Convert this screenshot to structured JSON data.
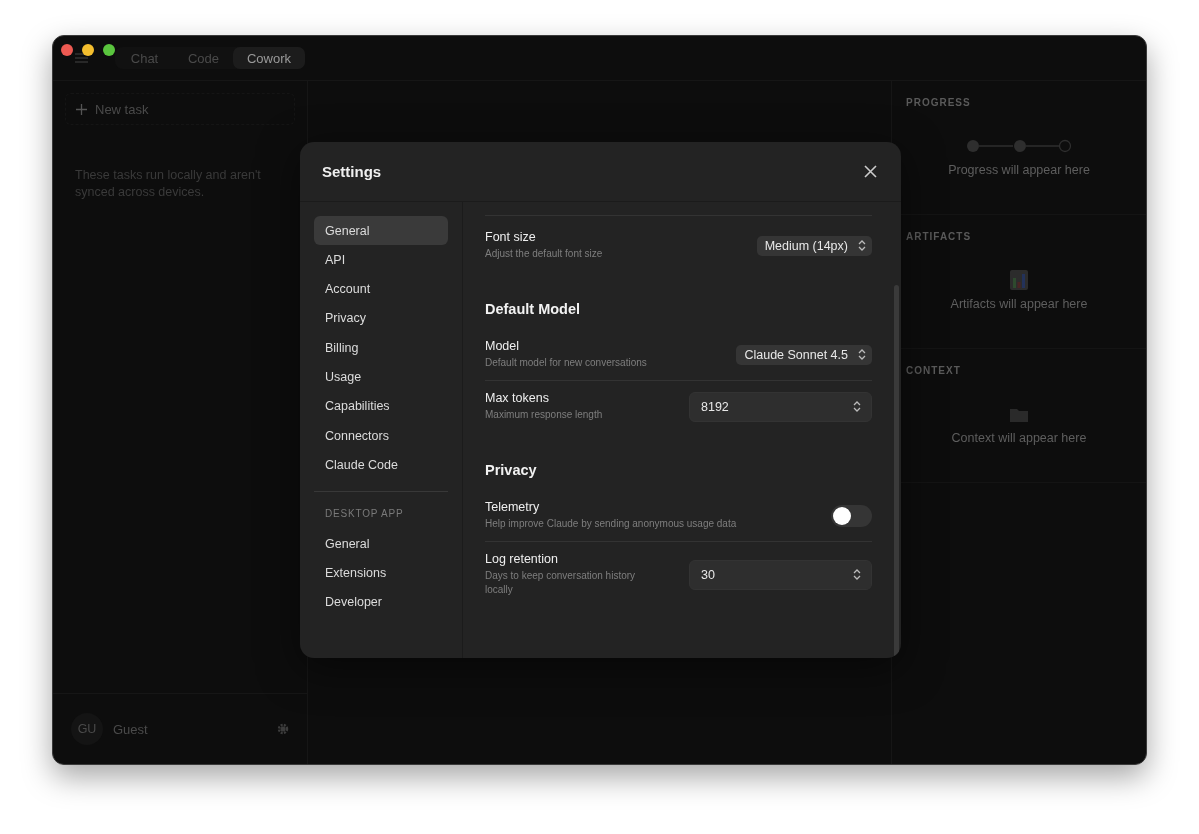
{
  "window": {
    "tabs": [
      {
        "label": "Chat",
        "selected": false
      },
      {
        "label": "Code",
        "selected": false
      },
      {
        "label": "Cowork",
        "selected": true
      }
    ]
  },
  "sidebar": {
    "new_task": "New task",
    "note": "These tasks run locally and aren't synced across devices.",
    "user": {
      "initials": "GU",
      "name": "Guest"
    }
  },
  "right_panel": {
    "sections": [
      {
        "kind": "progress",
        "title": "PROGRESS",
        "empty": "Progress will appear here"
      },
      {
        "kind": "artifacts",
        "title": "ARTIFACTS",
        "empty": "Artifacts will appear here"
      },
      {
        "kind": "context",
        "title": "CONTEXT",
        "empty": "Context will appear here"
      }
    ]
  },
  "settings": {
    "title": "Settings",
    "nav": [
      {
        "items": [
          {
            "label": "General",
            "selected": true
          },
          {
            "label": "API",
            "selected": false
          },
          {
            "label": "Account",
            "selected": false
          },
          {
            "label": "Privacy",
            "selected": false
          },
          {
            "label": "Billing",
            "selected": false
          },
          {
            "label": "Usage",
            "selected": false
          },
          {
            "label": "Capabilities",
            "selected": false
          },
          {
            "label": "Connectors",
            "selected": false
          },
          {
            "label": "Claude Code",
            "selected": false
          }
        ]
      },
      {
        "heading": "DESKTOP APP",
        "items": [
          {
            "label": "General",
            "selected": false
          },
          {
            "label": "Extensions",
            "selected": false
          },
          {
            "label": "Developer",
            "selected": false
          }
        ]
      }
    ],
    "sections": [
      {
        "rows": [
          {
            "kind": "select",
            "label": "Font size",
            "description": "Adjust the default font size",
            "value": "Medium (14px)"
          }
        ]
      },
      {
        "heading": "Default Model",
        "rows": [
          {
            "kind": "select",
            "label": "Model",
            "description": "Default model for new conversations",
            "value": "Claude Sonnet 4.5"
          },
          {
            "kind": "number",
            "label": "Max tokens",
            "description": "Maximum response length",
            "value": "8192"
          }
        ]
      },
      {
        "heading": "Privacy",
        "rows": [
          {
            "kind": "toggle",
            "label": "Telemetry",
            "description": "Help improve Claude by sending anonymous usage data",
            "on": false
          },
          {
            "kind": "number",
            "label": "Log retention",
            "description": "Days to keep conversation history locally",
            "value": "30"
          }
        ]
      }
    ]
  }
}
